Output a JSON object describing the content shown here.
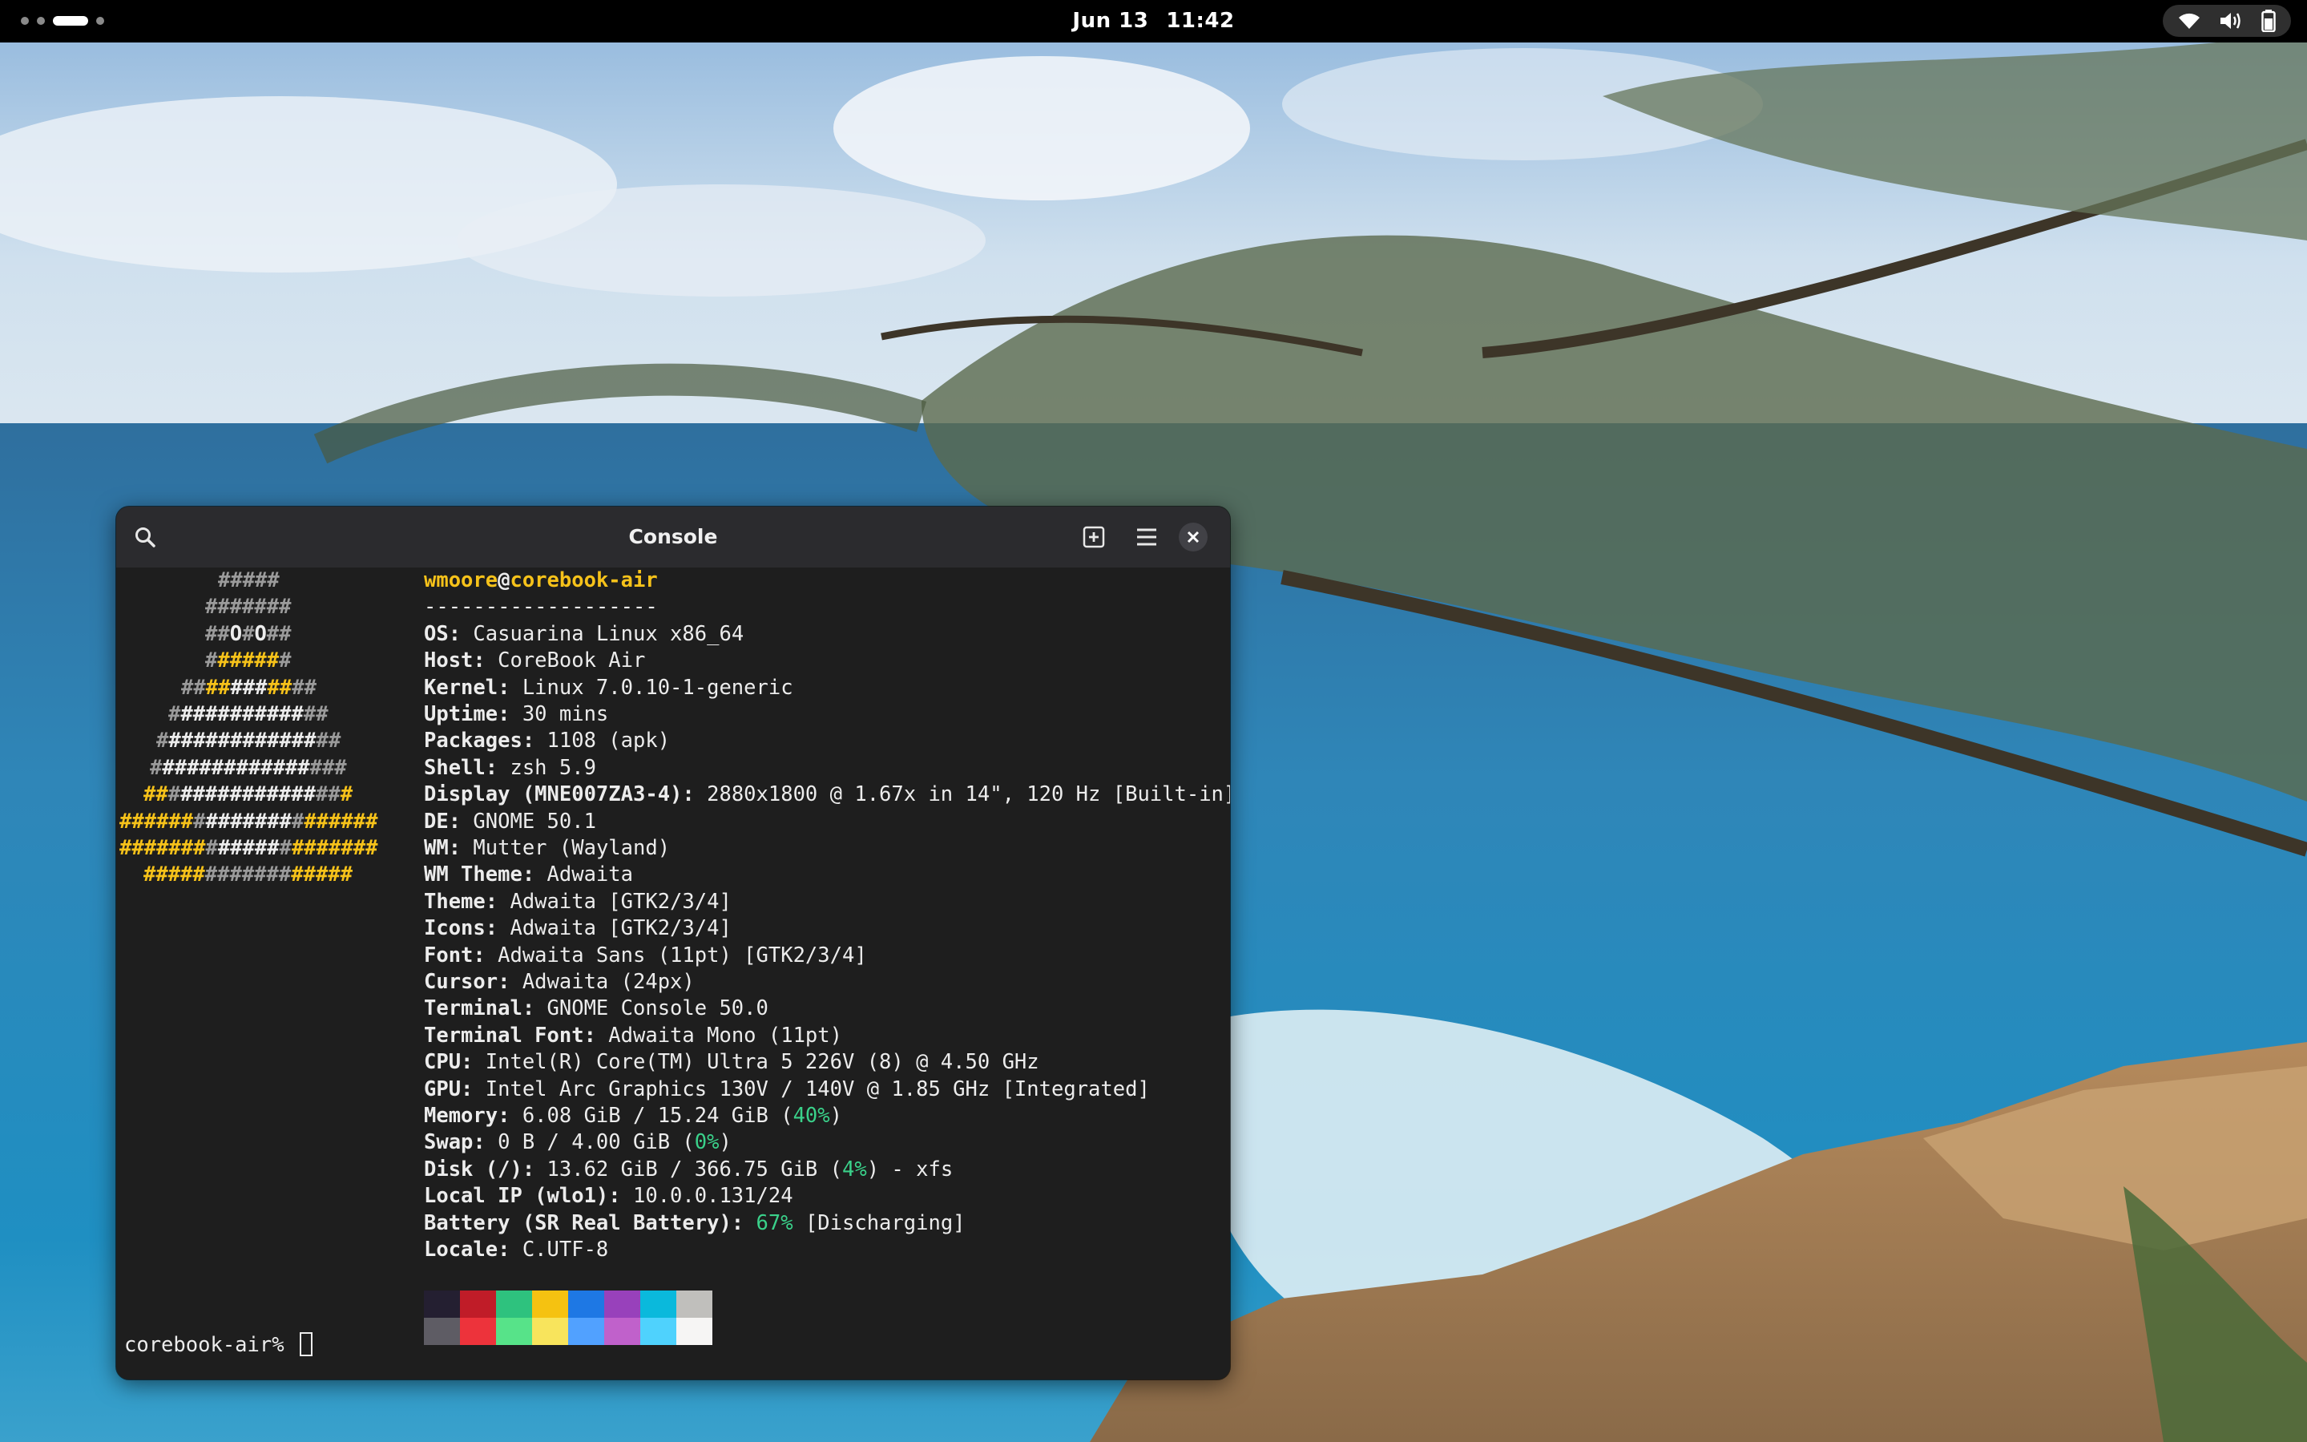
{
  "topbar": {
    "date": "Jun 13",
    "time": "11:42",
    "status_icons": [
      "wifi-icon",
      "volume-icon",
      "battery-icon"
    ]
  },
  "window": {
    "title": "Console",
    "buttons": [
      "search-icon",
      "new-tab-icon",
      "menu-icon",
      "close-icon"
    ]
  },
  "logo": [
    [
      [
        "g",
        "#####"
      ]
    ],
    [
      [
        "g",
        "#######"
      ]
    ],
    [
      [
        "g",
        "##"
      ],
      [
        "w",
        "O"
      ],
      [
        "g",
        "#"
      ],
      [
        "w",
        "O"
      ],
      [
        "g",
        "##"
      ]
    ],
    [
      [
        "g",
        "#"
      ],
      [
        "y",
        "#####"
      ],
      [
        "g",
        "#"
      ]
    ],
    [
      [
        "g",
        "##"
      ],
      [
        "y",
        "##"
      ],
      [
        "w",
        "###"
      ],
      [
        "y",
        "##"
      ],
      [
        "g",
        "##"
      ]
    ],
    [
      [
        "g",
        "#"
      ],
      [
        "w",
        "##########"
      ],
      [
        "g",
        "##"
      ]
    ],
    [
      [
        "g",
        "#"
      ],
      [
        "w",
        "############"
      ],
      [
        "g",
        "##"
      ]
    ],
    [
      [
        "g",
        "#"
      ],
      [
        "w",
        "############"
      ],
      [
        "g",
        "###"
      ]
    ],
    [
      [
        "y",
        "##"
      ],
      [
        "g",
        "#"
      ],
      [
        "w",
        "###########"
      ],
      [
        "g",
        "##"
      ],
      [
        "y",
        "#"
      ]
    ],
    [
      [
        "y",
        "######"
      ],
      [
        "g",
        "#"
      ],
      [
        "w",
        "#######"
      ],
      [
        "g",
        "#"
      ],
      [
        "y",
        "######"
      ]
    ],
    [
      [
        "y",
        "#######"
      ],
      [
        "g",
        "#"
      ],
      [
        "w",
        "#####"
      ],
      [
        "g",
        "#"
      ],
      [
        "y",
        "#######"
      ]
    ],
    [
      [
        "y",
        "#####"
      ],
      [
        "g",
        "#######"
      ],
      [
        "y",
        "#####"
      ]
    ]
  ],
  "fetch": {
    "user": "wmoore",
    "at": "@",
    "host": "corebook-air",
    "separator": "-------------------",
    "os": {
      "label": "OS:",
      "value": " Casuarina Linux x86_64"
    },
    "host_info": {
      "label": "Host:",
      "value": " CoreBook Air"
    },
    "kernel": {
      "label": "Kernel:",
      "value": " Linux 7.0.10-1-generic"
    },
    "uptime": {
      "label": "Uptime:",
      "value": " 30 mins"
    },
    "packages": {
      "label": "Packages:",
      "value": " 1108 (apk)"
    },
    "shell": {
      "label": "Shell:",
      "value": " zsh 5.9"
    },
    "display": {
      "label": "Display (MNE007ZA3-4):",
      "value": " 2880x1800 @ 1.67x in 14\", 120 Hz [Built-in]"
    },
    "de": {
      "label": "DE:",
      "value": " GNOME 50.1"
    },
    "wm": {
      "label": "WM:",
      "value": " Mutter (Wayland)"
    },
    "wm_theme": {
      "label": "WM Theme:",
      "value": " Adwaita"
    },
    "theme": {
      "label": "Theme:",
      "value": " Adwaita [GTK2/3/4]"
    },
    "icons": {
      "label": "Icons:",
      "value": " Adwaita [GTK2/3/4]"
    },
    "font": {
      "label": "Font:",
      "value": " Adwaita Sans (11pt) [GTK2/3/4]"
    },
    "cursor": {
      "label": "Cursor:",
      "value": " Adwaita (24px)"
    },
    "terminal": {
      "label": "Terminal:",
      "value": " GNOME Console 50.0"
    },
    "terminal_font": {
      "label": "Terminal Font:",
      "value": " Adwaita Mono (11pt)"
    },
    "cpu": {
      "label": "CPU:",
      "value": " Intel(R) Core(TM) Ultra 5 226V (8) @ 4.50 GHz"
    },
    "gpu": {
      "label": "GPU:",
      "value": " Intel Arc Graphics 130V / 140V @ 1.85 GHz [Integrated]"
    },
    "memory": {
      "label": "Memory:",
      "value": " 6.08 GiB / 15.24 GiB (",
      "pct": "40%",
      "tail": ")"
    },
    "swap": {
      "label": "Swap:",
      "value": " 0 B / 4.00 GiB (",
      "pct": "0%",
      "tail": ")"
    },
    "disk": {
      "label": "Disk (/):",
      "value": " 13.62 GiB / 366.75 GiB (",
      "pct": "4%",
      "tail": ") - xfs"
    },
    "local_ip": {
      "label": "Local IP (wlo1):",
      "value": " 10.0.0.131/24"
    },
    "battery": {
      "label": "Battery (SR Real Battery):",
      "pre": " ",
      "pct": "67%",
      "value": " [Discharging]"
    },
    "locale": {
      "label": "Locale:",
      "value": " C.UTF-8"
    }
  },
  "palette": {
    "top": [
      "#241f31",
      "#c01c28",
      "#2ec27e",
      "#f5c211",
      "#1e78e4",
      "#9841bb",
      "#0ab9dc",
      "#c0bfbc"
    ],
    "bottom": [
      "#5e5c64",
      "#ed333b",
      "#57e389",
      "#f8e45c",
      "#51a1ff",
      "#c061cb",
      "#4fd2fd",
      "#f6f5f4"
    ]
  },
  "prompt": "corebook-air% "
}
